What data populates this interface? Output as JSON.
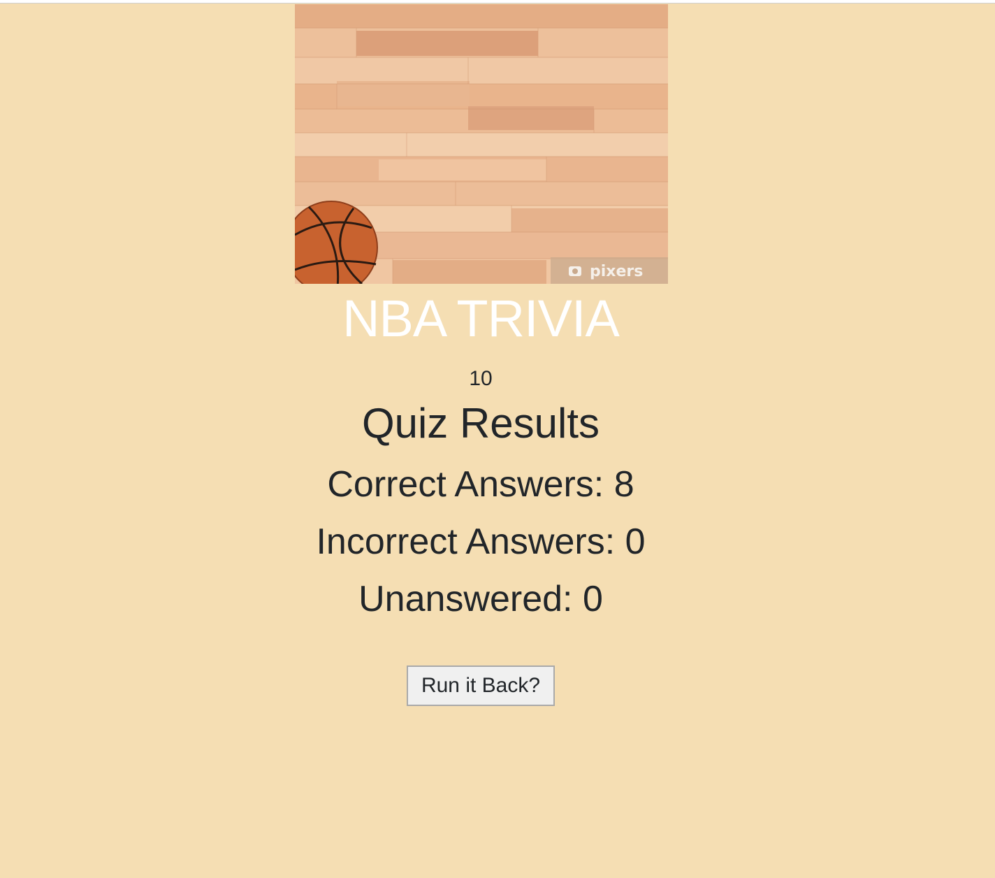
{
  "banner": {
    "watermark": "pixers",
    "icon": "camera-icon"
  },
  "header": {
    "title": "NBA TRIVIA"
  },
  "timer": {
    "value": "10"
  },
  "results": {
    "heading": "Quiz Results",
    "correct": "Correct Answers: 8",
    "incorrect": "Incorrect Answers: 0",
    "unanswered": "Unanswered: 0"
  },
  "actions": {
    "restart_label": "Run it Back?"
  },
  "colors": {
    "background": "#f5deb3",
    "title": "#ffffff",
    "text": "#212529"
  }
}
